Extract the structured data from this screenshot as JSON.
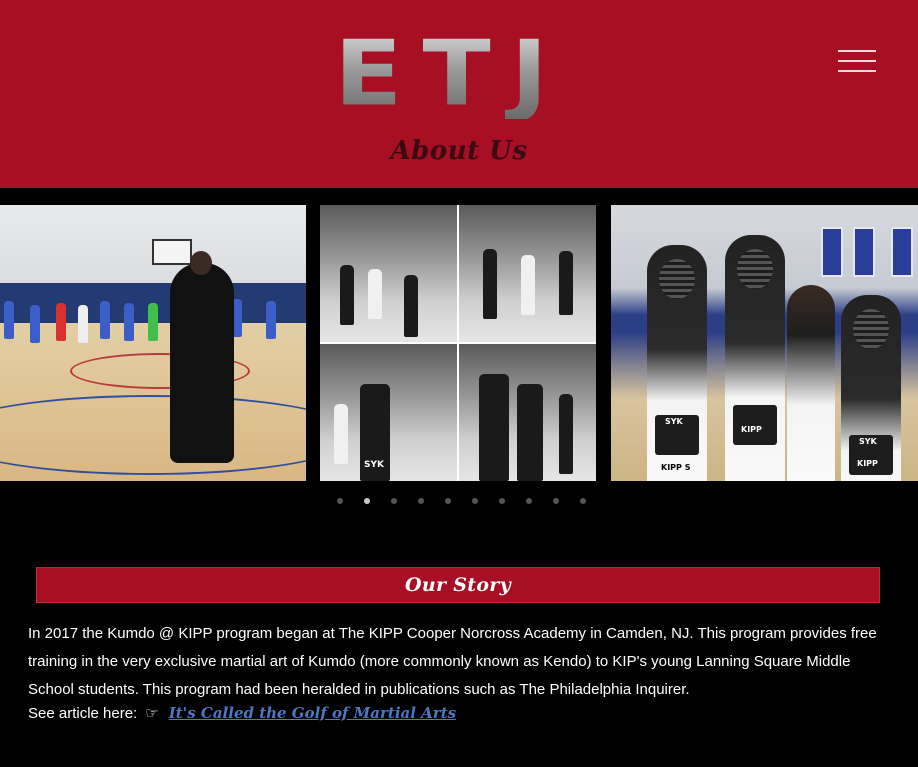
{
  "header": {
    "logo_text": "ETJ",
    "page_title": "About Us",
    "menu_icon": "hamburger-menu-icon",
    "background_color": "#a60f24"
  },
  "gallery": {
    "slides": [
      {
        "description_icon": "photo",
        "alt": ""
      },
      {
        "description_icon": "photo",
        "alt": ""
      },
      {
        "description_icon": "photo",
        "alt": ""
      }
    ],
    "slide_labels": {
      "bogu_1": "SYK",
      "bogu_1b": "KIPP S",
      "bogu_2": "KIPP",
      "bogu_3": "SYK",
      "bogu_3b": "KIPP",
      "collage_tag": "SYK"
    },
    "dot_count": 10,
    "active_dot_index": 1
  },
  "story": {
    "heading": "Our Story",
    "paragraph": "In 2017 the Kumdo @ KIPP program began at The KIPP Cooper Norcross Academy in Camden, NJ. This program provides free training in the very exclusive martial art of Kumdo (more commonly known as Kendo) to KIP's young Lanning Square Middle School students. This program had been heralded in publications such as The Philadelphia Inquirer.",
    "article_prefix": "See article here:",
    "article_icon": "pointing-hand-icon",
    "article_link": "It's Called the Golf of Martial Arts",
    "link_color": "#4a79c2"
  }
}
